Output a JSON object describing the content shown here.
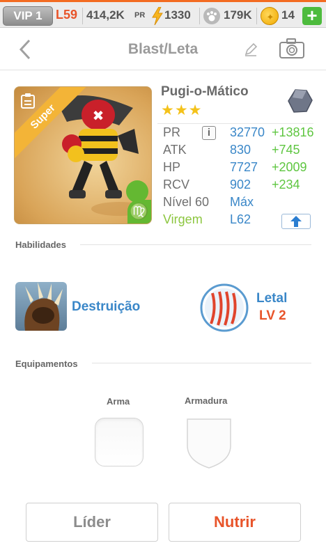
{
  "topbar": {
    "vip": "VIP 1",
    "level": "L59",
    "power": "414,2K",
    "power_unit": "PR",
    "energy": "1330",
    "food": "179K",
    "gold": "14",
    "add_label": "+",
    "accent_color": "#f36b21"
  },
  "header": {
    "title": "Blast/Leta",
    "back_icon": "chevron-left-icon",
    "edit_icon": "pencil-icon",
    "camera_icon": "camera-icon"
  },
  "monster": {
    "rarity": "Super",
    "name": "Pugi-o-Mático",
    "stars": "★★★",
    "star_count": 3,
    "zodiac_symbol": "♍",
    "element_icon": "rock-element-icon"
  },
  "stats": [
    {
      "label": "PR",
      "value": "32770",
      "bonus": "+13816"
    },
    {
      "label": "ATK",
      "value": "830",
      "bonus": "+745"
    },
    {
      "label": "HP",
      "value": "7727",
      "bonus": "+2009"
    },
    {
      "label": "RCV",
      "value": "902",
      "bonus": "+234"
    },
    {
      "label": "Nível 60",
      "value": "Máx",
      "bonus": ""
    },
    {
      "label": "Virgem",
      "value": "L62",
      "bonus": ""
    }
  ],
  "info_label": "i",
  "abilities": {
    "title": "Habilidades",
    "skill_name": "Destruição",
    "leader_name": "Letal",
    "leader_level": "LV 2"
  },
  "equipment": {
    "title": "Equipamentos",
    "weapon_label": "Arma",
    "armor_label": "Armadura"
  },
  "buttons": {
    "leader": "Líder",
    "feed": "Nutrir"
  },
  "colors": {
    "blue": "#3a87c8",
    "green": "#5ec640",
    "orange": "#e8542a",
    "star": "#f4c21a"
  }
}
